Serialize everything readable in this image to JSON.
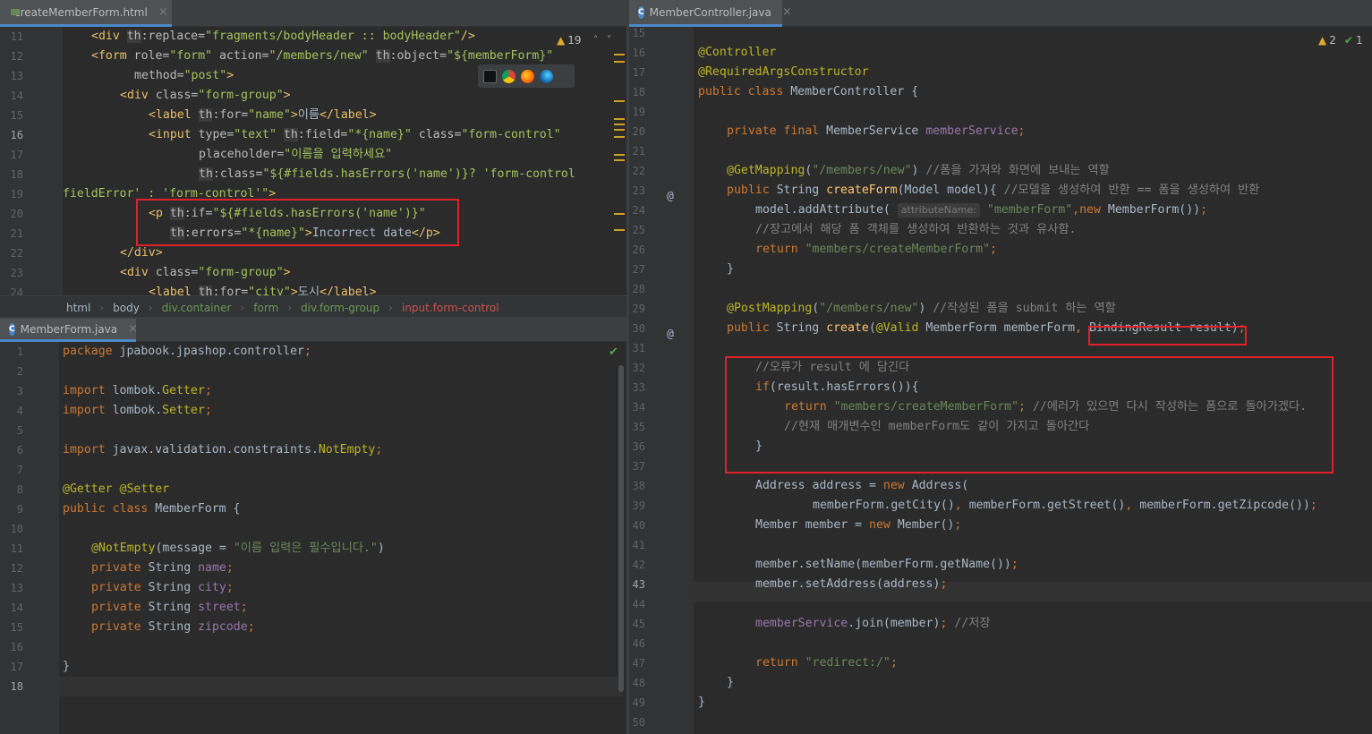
{
  "top_left_tab": {
    "label": "createMemberForm.html",
    "close": "×"
  },
  "bottom_left_tab": {
    "label": "MemberForm.java",
    "close": "×"
  },
  "right_tab": {
    "label": "MemberController.java",
    "close": "×"
  },
  "html_editor": {
    "warnings": "19",
    "lines": [
      {
        "n": "11",
        "html": "<span class='t'>&lt;div</span> <span class='th'>th</span><span class='a'>:replace=</span><span class='v'>\"fragments/bodyHeader :: bodyHeader\"</span><span class='t'>/&gt;</span>",
        "indent": 32
      },
      {
        "n": "12",
        "html": "<span class='t'>&lt;form</span> <span class='a'>role=</span><span class='v'>\"form\"</span> <span class='a'>action=</span><span class='v'>\"/members/new\"</span> <span class='th'>th</span><span class='a'>:object=</span><span class='v'>\"${memberForm}\"</span>",
        "indent": 32
      },
      {
        "n": "13",
        "html": "<span class='a'>method=</span><span class='v'>\"post\"</span><span class='t'>&gt;</span>",
        "indent": 80
      },
      {
        "n": "14",
        "html": "<span class='t'>&lt;div</span> <span class='a'>class=</span><span class='v'>\"form-group\"</span><span class='t'>&gt;</span>",
        "indent": 64
      },
      {
        "n": "15",
        "html": "<span class='t'>&lt;label</span> <span class='th'>th</span><span class='a'>:for=</span><span class='v'>\"name\"</span><span class='t'>&gt;</span>이름<span class='t'>&lt;/label&gt;</span>",
        "indent": 96
      },
      {
        "n": "16",
        "html": "<span class='t'>&lt;input</span> <span class='a'>type=</span><span class='v'>\"text\"</span> <span class='th'>th</span><span class='a'>:field=</span><span class='v'>\"*{name}\"</span> <span class='a'>class=</span><span class='v'>\"form-control\"</span>",
        "indent": 96
      },
      {
        "n": "17",
        "html": "<span class='a'>placeholder=</span><span class='v'>\"이름을 입력하세요\"</span>",
        "indent": 152
      },
      {
        "n": "18",
        "html": "<span class='th'>th</span><span class='a'>:class=</span><span class='v'>\"${#fields.hasErrors('name')}? 'form-control</span>",
        "indent": 152
      },
      {
        "n": "19",
        "html": "<span class='v'>fieldError' : 'form-control'\"</span><span class='t'>&gt;</span>",
        "indent": 0
      },
      {
        "n": "20",
        "html": "<span class='t'>&lt;p</span> <span class='th'>th</span><span class='a'>:if=</span><span class='v'>\"${#fields.hasErrors('name')}\"</span>",
        "indent": 96
      },
      {
        "n": "21",
        "html": "<span class='th'>th</span><span class='a'>:errors=</span><span class='v'>\"*{name}\"</span><span class='t'>&gt;</span>Incorrect date<span class='t'>&lt;/p&gt;</span>",
        "indent": 120
      },
      {
        "n": "22",
        "html": "<span class='t'>&lt;/div&gt;</span>",
        "indent": 64
      },
      {
        "n": "23",
        "html": "<span class='t'>&lt;div</span> <span class='a'>class=</span><span class='v'>\"form-group\"</span><span class='t'>&gt;</span>",
        "indent": 64
      },
      {
        "n": "24",
        "html": "<span class='t'>&lt;label</span> <span class='th'>th</span><span class='a'>:for=</span><span class='v'>\"city\"</span><span class='t'>&gt;</span>도시<span class='t'>&lt;/label&gt;</span>",
        "indent": 96
      }
    ]
  },
  "breadcrumb": [
    "html",
    "body",
    "div.container",
    "form",
    "div.form-group",
    "input.form-control"
  ],
  "java_form_editor": {
    "lines": [
      {
        "n": "1",
        "html": "<span class='kw'>package</span> jpabook.jpashop.controller<span class='kw'>;</span>",
        "indent": 0
      },
      {
        "n": "2",
        "html": "",
        "indent": 0
      },
      {
        "n": "3",
        "html": "<span class='kw'>import</span> lombok.<span class='ann'>Getter</span><span class='kw'>;</span>",
        "indent": 0
      },
      {
        "n": "4",
        "html": "<span class='kw'>import</span> lombok.<span class='ann'>Setter</span><span class='kw'>;</span>",
        "indent": 0
      },
      {
        "n": "5",
        "html": "",
        "indent": 0
      },
      {
        "n": "6",
        "html": "<span class='kw'>import</span> javax.validation.constraints.<span class='ann'>NotEmpty</span><span class='kw'>;</span>",
        "indent": 0
      },
      {
        "n": "7",
        "html": "",
        "indent": 0
      },
      {
        "n": "8",
        "html": "<span class='ann'>@Getter</span> <span class='ann'>@Setter</span>",
        "indent": 0
      },
      {
        "n": "9",
        "html": "<span class='kw'>public class</span> MemberForm {",
        "indent": 0
      },
      {
        "n": "10",
        "html": "",
        "indent": 0
      },
      {
        "n": "11",
        "html": "<span class='ann'>@NotEmpty</span>(message = <span class='str'>\"이름 입력은 필수입니다.\"</span>)",
        "indent": 32
      },
      {
        "n": "12",
        "html": "<span class='kw'>private</span> String <span class='fld'>name</span><span class='kw'>;</span>",
        "indent": 32
      },
      {
        "n": "13",
        "html": "<span class='kw'>private</span> String <span class='fld'>city</span><span class='kw'>;</span>",
        "indent": 32
      },
      {
        "n": "14",
        "html": "<span class='kw'>private</span> String <span class='fld'>street</span><span class='kw'>;</span>",
        "indent": 32
      },
      {
        "n": "15",
        "html": "<span class='kw'>private</span> String <span class='fld'>zipcode</span><span class='kw'>;</span>",
        "indent": 32
      },
      {
        "n": "16",
        "html": "",
        "indent": 0
      },
      {
        "n": "17",
        "html": "}",
        "indent": 0
      },
      {
        "n": "18",
        "html": "",
        "indent": 0
      }
    ]
  },
  "controller_editor": {
    "warnings": "2",
    "checks": "1",
    "param_hint": "attributeName:",
    "lines": [
      {
        "n": "15",
        "html": "",
        "indent": 0
      },
      {
        "n": "16",
        "html": "<span class='ann'>@Controller</span>",
        "indent": 0
      },
      {
        "n": "17",
        "html": "<span class='ann'>@RequiredArgsConstructor</span>",
        "indent": 0
      },
      {
        "n": "18",
        "html": "<span class='kw'>public class</span> MemberController {",
        "indent": 0
      },
      {
        "n": "19",
        "html": "",
        "indent": 0
      },
      {
        "n": "20",
        "html": "<span class='kw'>private final</span> MemberService <span class='fld'>memberService</span><span class='kw'>;</span>",
        "indent": 32
      },
      {
        "n": "21",
        "html": "",
        "indent": 0
      },
      {
        "n": "22",
        "html": "<span class='ann'>@GetMapping</span>(<span class='str'>\"/members/new\"</span>) <span class='cm'>//폼을 가져와 화면에 보내는 역할</span>",
        "indent": 32
      },
      {
        "n": "23",
        "html": "<span class='kw'>public</span> String <span class='fn'>createForm</span>(Model model){ <span class='cm'>//모델을 생성하여 반환 == 폼을 생성하여 반환</span>",
        "indent": 32
      },
      {
        "n": "24",
        "html": "model.addAttribute( <span class='param-hint'>attributeName:</span> <span class='str'>\"memberForm\"</span><span class='kw'>,new</span> MemberForm())<span class='kw'>;</span>",
        "indent": 64
      },
      {
        "n": "25",
        "html": "<span class='cm'>//장고에서 해당 폼 객체를 생성하여 반환하는 것과 유사함.</span>",
        "indent": 64
      },
      {
        "n": "26",
        "html": "<span class='kw'>return</span> <span class='str'>\"members/createMemberForm\"</span><span class='kw'>;</span>",
        "indent": 64
      },
      {
        "n": "27",
        "html": "}",
        "indent": 32
      },
      {
        "n": "28",
        "html": "",
        "indent": 0
      },
      {
        "n": "29",
        "html": "<span class='ann'>@PostMapping</span>(<span class='str'>\"/members/new\"</span>) <span class='cm'>//작성된 폼을 submit 하는 역할</span>",
        "indent": 32
      },
      {
        "n": "30",
        "html": "<span class='kw'>public</span> String <span class='fn'>create</span>(<span class='ann'>@Valid</span> MemberForm memberForm<span class='kw'>,</span> BindingResult result)<span class='kw'>;</span>",
        "indent": 32
      },
      {
        "n": "31",
        "html": "",
        "indent": 0
      },
      {
        "n": "32",
        "html": "<span class='cm'>//오류가 result 에 담긴다</span>",
        "indent": 64
      },
      {
        "n": "33",
        "html": "<span class='kw'>if</span>(result.hasErrors()){",
        "indent": 64
      },
      {
        "n": "34",
        "html": "<span class='kw'>return</span> <span class='str'>\"members/createMemberForm\"</span><span class='kw'>;</span> <span class='cm'>//에러가 있으면 다시 작성하는 폼으로 돌아가겠다.</span>",
        "indent": 96
      },
      {
        "n": "35",
        "html": "<span class='cm'>//현재 매개변수인 memberForm도 같이 가지고 돌아간다</span>",
        "indent": 96
      },
      {
        "n": "36",
        "html": "}",
        "indent": 64
      },
      {
        "n": "37",
        "html": "",
        "indent": 0
      },
      {
        "n": "38",
        "html": "Address address = <span class='kw'>new</span> Address(",
        "indent": 64
      },
      {
        "n": "39",
        "html": "memberForm.getCity()<span class='kw'>,</span> memberForm.getStreet()<span class='kw'>,</span> memberForm.getZipcode())<span class='kw'>;</span>",
        "indent": 128
      },
      {
        "n": "40",
        "html": "Member member = <span class='kw'>new</span> Member()<span class='kw'>;</span>",
        "indent": 64
      },
      {
        "n": "41",
        "html": "",
        "indent": 0
      },
      {
        "n": "42",
        "html": "member.setName(memberForm.getName())<span class='kw'>;</span>",
        "indent": 64
      },
      {
        "n": "43",
        "html": "member.setAddress(address)<span class='kw'>;</span>",
        "indent": 64
      },
      {
        "n": "44",
        "html": "",
        "indent": 0
      },
      {
        "n": "45",
        "html": "<span class='fld'>memberService</span>.join(member)<span class='kw'>;</span> <span class='cm'>//저장</span>",
        "indent": 64
      },
      {
        "n": "46",
        "html": "",
        "indent": 0
      },
      {
        "n": "47",
        "html": "<span class='kw'>return</span> <span class='str'>\"redirect:/\"</span><span class='kw'>;</span>",
        "indent": 64
      },
      {
        "n": "48",
        "html": "}",
        "indent": 32
      },
      {
        "n": "49",
        "html": "}",
        "indent": 0
      },
      {
        "n": "50",
        "html": "",
        "indent": 0
      }
    ]
  }
}
